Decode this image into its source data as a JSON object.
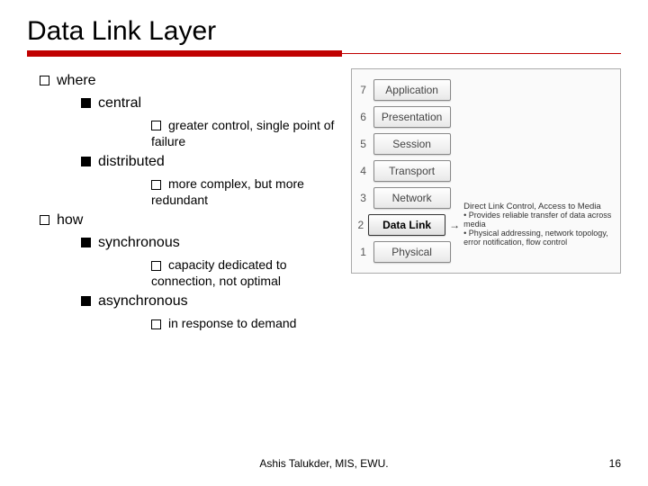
{
  "title": "Data Link Layer",
  "bullets": {
    "where": {
      "label": "where",
      "central": {
        "label": "central",
        "note": "greater control, single point of failure"
      },
      "distributed": {
        "label": "distributed",
        "note": "more complex, but more redundant"
      }
    },
    "how": {
      "label": "how",
      "synchronous": {
        "label": "synchronous",
        "note": "capacity dedicated to connection, not optimal"
      },
      "asynchronous": {
        "label": "asynchronous",
        "note": "in response to demand"
      }
    }
  },
  "osi": {
    "layers": [
      {
        "n": "7",
        "name": "Application"
      },
      {
        "n": "6",
        "name": "Presentation"
      },
      {
        "n": "5",
        "name": "Session"
      },
      {
        "n": "4",
        "name": "Transport"
      },
      {
        "n": "3",
        "name": "Network"
      },
      {
        "n": "2",
        "name": "Data Link"
      },
      {
        "n": "1",
        "name": "Physical"
      }
    ],
    "callout": {
      "heading": "Direct Link Control, Access to Media",
      "line1": "• Provides reliable transfer of data across media",
      "line2": "• Physical addressing, network topology, error notification, flow control"
    }
  },
  "footer": "Ashis Talukder, MIS, EWU.",
  "page": "16"
}
